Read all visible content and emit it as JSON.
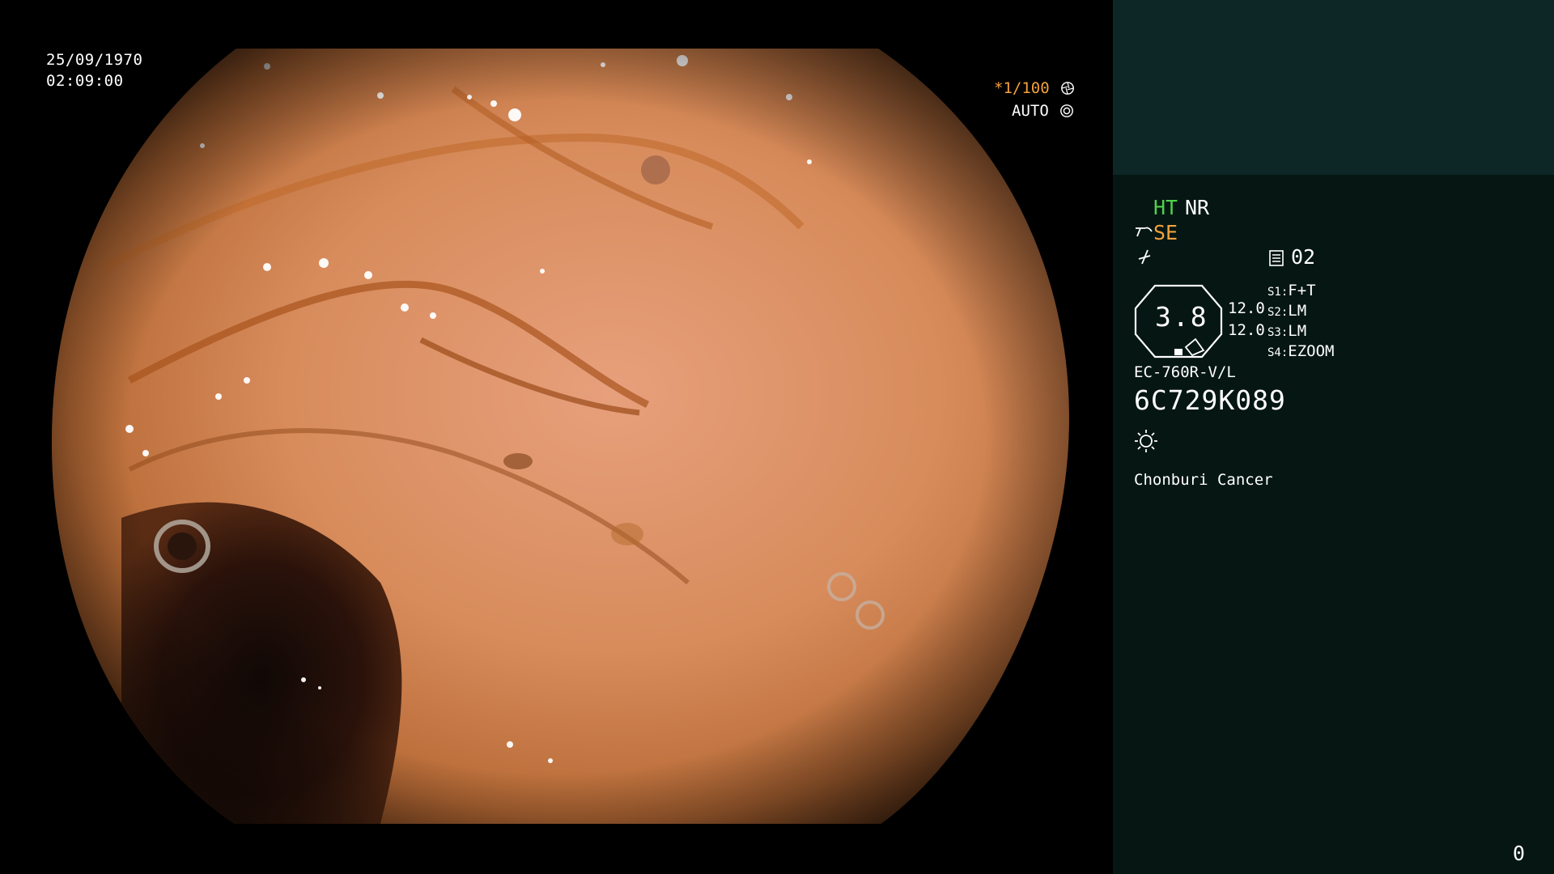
{
  "overlay": {
    "date": "25/09/1970",
    "time": "02:09:00",
    "shutter": "*1/100",
    "exposure_mode": "AUTO"
  },
  "panel": {
    "enhance_mode": "HT",
    "noise_reduction": "NR",
    "structure_enhance": "SE",
    "memory_slot": "02",
    "zoom_value": "3.8",
    "value_a": "12.0",
    "value_b": "12.0",
    "switches": [
      {
        "key": "S1:",
        "value": "F+T"
      },
      {
        "key": "S2:",
        "value": "LM"
      },
      {
        "key": "S3:",
        "value": "LM"
      },
      {
        "key": "S4:",
        "value": "EZOOM"
      }
    ],
    "scope_model": "EC-760R-V/L",
    "scope_serial": "6C729K089",
    "institution": "Chonburi Cancer",
    "frame_counter": "0"
  },
  "colors": {
    "accent_green": "#4fd24a",
    "accent_orange": "#f2a23c",
    "panel_bg": "#051613",
    "panel_top_bg": "#0d2727"
  },
  "icons": [
    "shutter-aperture-icon",
    "auto-iris-icon",
    "structure-enhance-icon",
    "color-mode-icon",
    "memory-icon",
    "zoom-octagon-icon",
    "light-sun-icon"
  ]
}
